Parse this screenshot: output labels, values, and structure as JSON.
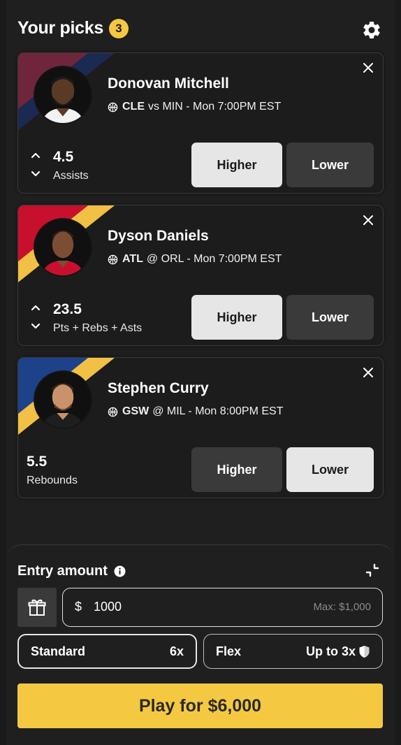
{
  "header": {
    "title": "Your picks",
    "count": "3"
  },
  "cards": [
    {
      "player": "Donovan Mitchell",
      "team": "CLE",
      "matchup": "vs MIN - Mon 7:00PM EST",
      "line": "4.5",
      "stat": "Assists",
      "higher_label": "Higher",
      "lower_label": "Lower",
      "selected": "higher",
      "colors": [
        "#6f263d",
        "#041e42"
      ]
    },
    {
      "player": "Dyson Daniels",
      "team": "ATL",
      "matchup": "@ ORL - Mon 7:00PM EST",
      "line": "23.5",
      "stat": "Pts + Rebs + Asts",
      "higher_label": "Higher",
      "lower_label": "Lower",
      "selected": "higher",
      "colors": [
        "#c8102e",
        "#fdb927"
      ]
    },
    {
      "player": "Stephen Curry",
      "team": "GSW",
      "matchup": "@ MIL - Mon 8:00PM EST",
      "line": "5.5",
      "stat": "Rebounds",
      "higher_label": "Higher",
      "lower_label": "Lower",
      "selected": "lower",
      "colors": [
        "#1d428a",
        "#ffc72c"
      ]
    }
  ],
  "entry": {
    "title": "Entry amount",
    "currency": "$",
    "amount": "1000",
    "max": "Max: $1,000",
    "standard_label": "Standard",
    "standard_mult": "6x",
    "flex_label": "Flex",
    "flex_mult": "Up to 3x",
    "play_label": "Play for $6,000"
  },
  "colors": {
    "accent": "#f5c842",
    "selected_btn": "#e6e6e6",
    "unselected_btn": "#3a3a3a"
  }
}
